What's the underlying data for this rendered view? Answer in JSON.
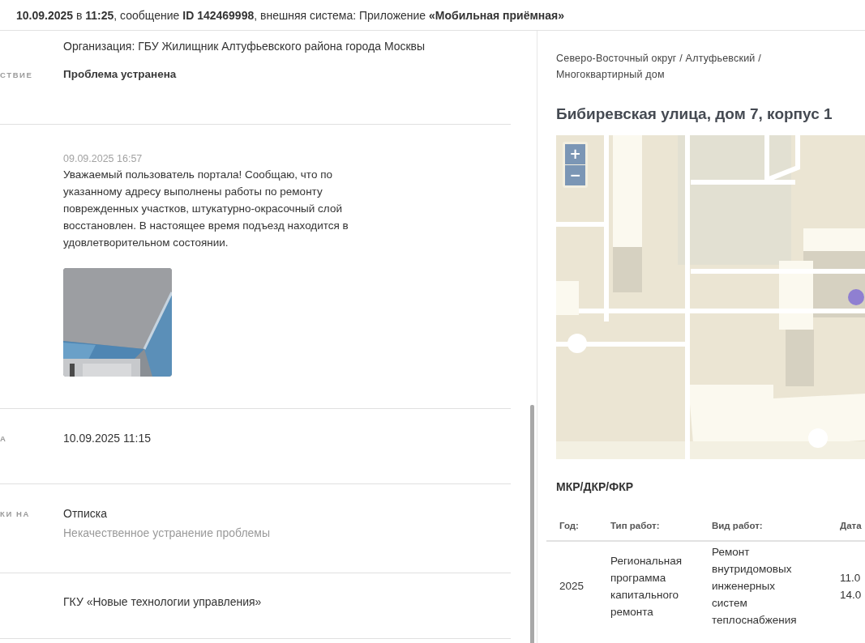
{
  "header": {
    "text": "**10.09.2025** в **11:25**, сообщение **ID 142469998**, внешняя система: Приложение **«Мобильная приёмная»**"
  },
  "details": {
    "organization": "Организация: ГБУ Жилищник Алтуфьевского района города Москвы",
    "rows": [
      {
        "kind": "field",
        "label": "СТВИЕ",
        "value": "Проблема устранена",
        "strong": true
      },
      {
        "kind": "comment",
        "date": "09.09.2025 16:57",
        "text": "Уважаемый пользователь портала! Сообщаю, что по указанному адресу выполнены работы по ремонту поврежденных участков, штукатурно-окрасочный слой восстановлен. В настоящее время подъезд находится в удовлетворительном состоянии."
      },
      {
        "kind": "field",
        "label": "А",
        "value": "10.09.2025 11:15",
        "strong": false
      },
      {
        "kind": "field",
        "label": "КИ НА",
        "value": "Отписка",
        "note": "Некачественное устранение проблемы",
        "strong": false
      },
      {
        "kind": "field",
        "value": "ГКУ «Новые технологии управления»",
        "strong": false
      }
    ]
  },
  "address": {
    "breadcrumbs": "Северо-Восточный округ / Алтуфьевский / Многоквартирный дом",
    "title": "Бибиревская улица, дом 7, корпус 1",
    "map": {
      "kind": "picture",
      "zoom_in": "+",
      "zoom_out": "−"
    }
  },
  "works": {
    "title": "МКР/ДКР/ФКР",
    "columns": [
      "Год:",
      "Тип работ:",
      "Вид работ:",
      "Дата"
    ],
    "rows": [
      {
        "year": "2025",
        "type": "Региональная программа капитального ремонта",
        "work": "Ремонт внутридомовых инженерных систем теплоснабжения",
        "dates": [
          "11.0",
          "14.0"
        ]
      }
    ]
  }
}
